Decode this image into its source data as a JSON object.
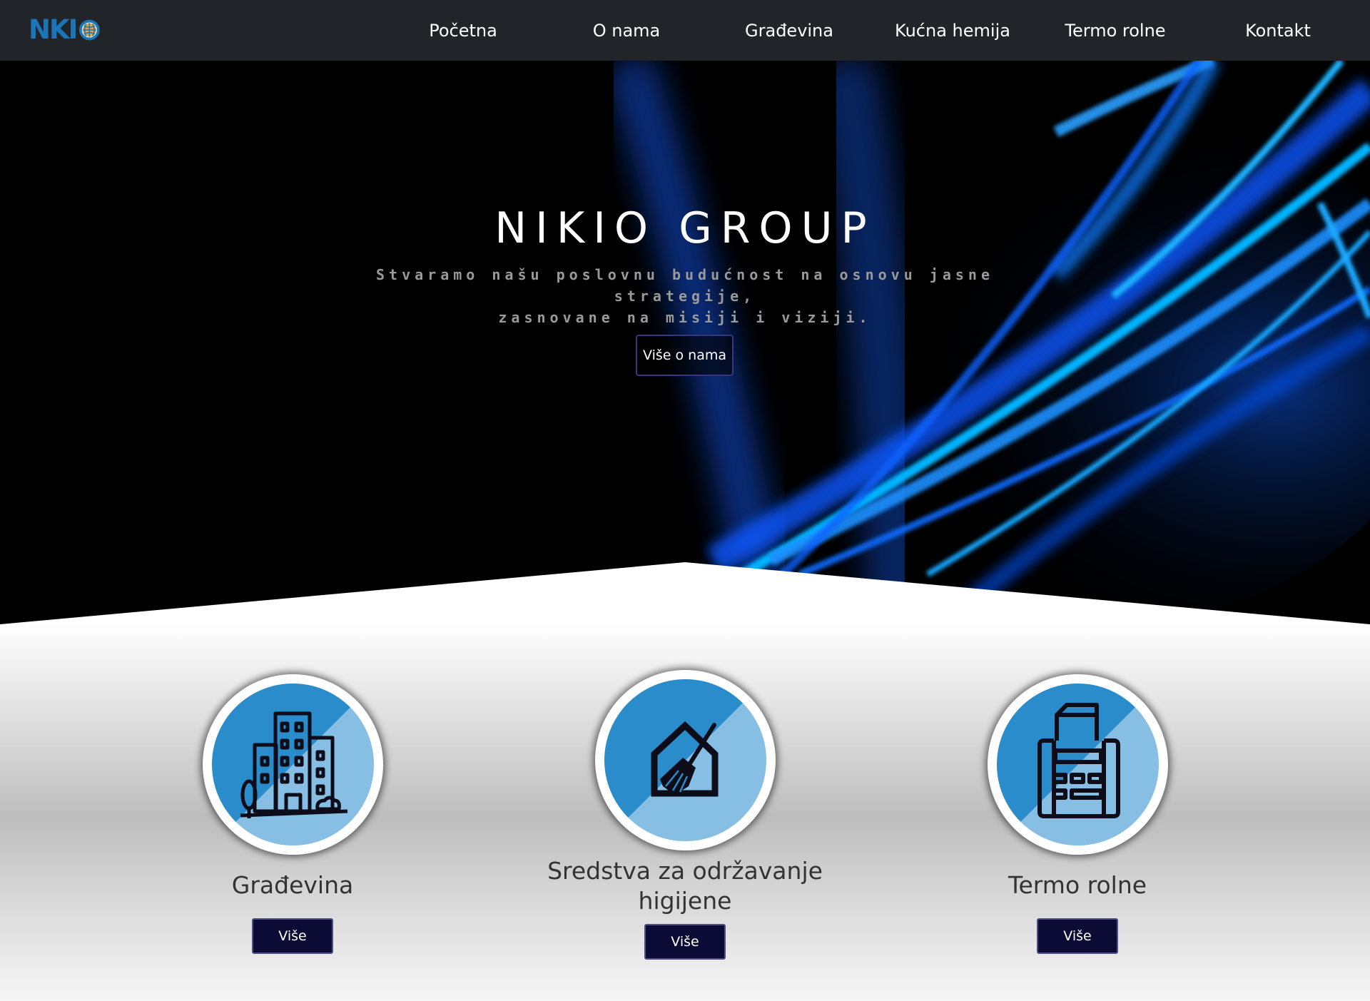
{
  "brand": {
    "logo_text": "NKI",
    "logo_alt": "NKIO"
  },
  "nav": {
    "items": [
      {
        "label": "Početna"
      },
      {
        "label": "O nama"
      },
      {
        "label": "Građevina"
      },
      {
        "label": "Kućna hemija"
      },
      {
        "label": "Termo rolne"
      },
      {
        "label": "Kontakt"
      }
    ]
  },
  "hero": {
    "title": "NIKIO GROUP",
    "subtitle_line1": "Stvaramo našu poslovnu budućnost na osnovu jasne strategije,",
    "subtitle_line2": "zasnovane na misiji i viziji.",
    "button_label": "Više o nama"
  },
  "services": [
    {
      "title": "Građevina",
      "button_label": "Više",
      "icon": "building-icon"
    },
    {
      "title_line1": "Sredstva za održavanje",
      "title_line2": "higijene",
      "button_label": "Više",
      "icon": "house-broom-icon"
    },
    {
      "title": "Termo rolne",
      "button_label": "Više",
      "icon": "cash-register-icon"
    }
  ],
  "colors": {
    "navbar_bg": "#212529",
    "logo_blue": "#1b76b8",
    "hero_bg": "#000000",
    "light_accent": "#00b4ff",
    "icon_dark_blue": "#2a8ccb",
    "icon_light_blue": "#86bfe3",
    "button_bg": "#0b0b35"
  }
}
